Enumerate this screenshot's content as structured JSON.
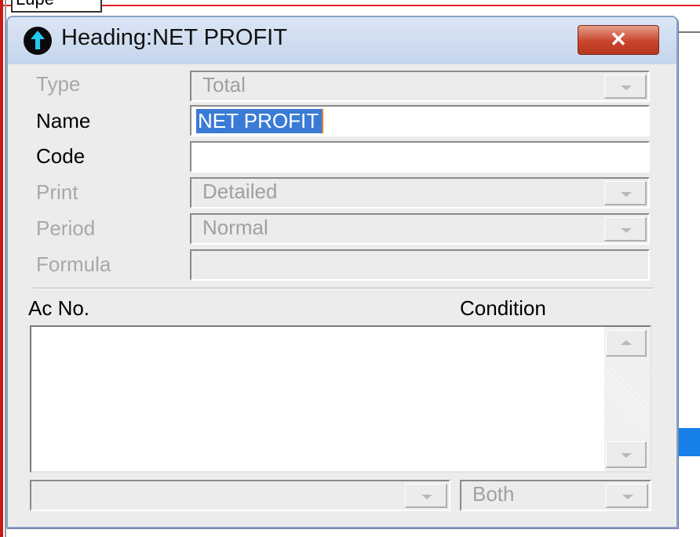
{
  "background": {
    "tab_label": "Lupe"
  },
  "dialog": {
    "title": "Heading:NET PROFIT",
    "close_label": "✕",
    "fields": {
      "type": {
        "label": "Type",
        "value": "Total"
      },
      "name": {
        "label": "Name",
        "value": "NET PROFIT"
      },
      "code": {
        "label": "Code",
        "value": ""
      },
      "print": {
        "label": "Print",
        "value": "Detailed"
      },
      "period": {
        "label": "Period",
        "value": "Normal"
      },
      "formula": {
        "label": "Formula",
        "value": ""
      }
    },
    "list": {
      "col_ac_no": "Ac No.",
      "col_condition": "Condition"
    },
    "bottom": {
      "account_select_value": "",
      "condition_select_value": "Both"
    }
  },
  "colors": {
    "titlebar": "#c5d5ec",
    "close_button": "#c9452b",
    "selection": "#3a7bd5",
    "dialog_bg": "#ececec"
  },
  "icons": [
    "arrow-up-icon",
    "close-icon",
    "chevron-down-icon",
    "scroll-up-icon",
    "scroll-down-icon"
  ]
}
